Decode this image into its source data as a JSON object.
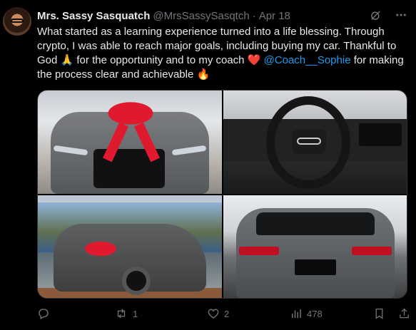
{
  "tweet": {
    "author": {
      "display_name": "Mrs. Sassy Sasquatch",
      "handle": "@MrsSassySasqtch",
      "separator": "·",
      "date": "Apr 18"
    },
    "body": {
      "line1": "What started as a learning experience turned into a life blessing. Through crypto, I was able to reach major goals, including buying my car. Thankful to God",
      "emoji_pray": "🙏",
      "line2": "for the opportunity and to my coach",
      "emoji_heart": "❤️",
      "mention": "@Coach__Sophie",
      "line3": "for making the process clear and achievable",
      "emoji_fire": "🔥"
    },
    "media": {
      "photos": [
        {
          "icon": "car-front-with-red-bow-photo"
        },
        {
          "icon": "steering-wheel-interior-photo"
        },
        {
          "icon": "car-side-in-showroom-photo"
        },
        {
          "icon": "car-rear-photo"
        }
      ]
    },
    "actions": {
      "replies": "",
      "retweets": "1",
      "likes": "2",
      "views": "478"
    },
    "icons": {
      "grok": "grok-icon",
      "more": "more-icon",
      "reply": "reply-icon",
      "retweet": "retweet-icon",
      "like": "heart-icon",
      "views": "views-icon",
      "bookmark": "bookmark-icon",
      "share": "share-icon"
    },
    "colors": {
      "background": "#000000",
      "text": "#e7e9ea",
      "secondary": "#71767b",
      "link": "#1d9bf0",
      "border": "#2f3336"
    }
  }
}
